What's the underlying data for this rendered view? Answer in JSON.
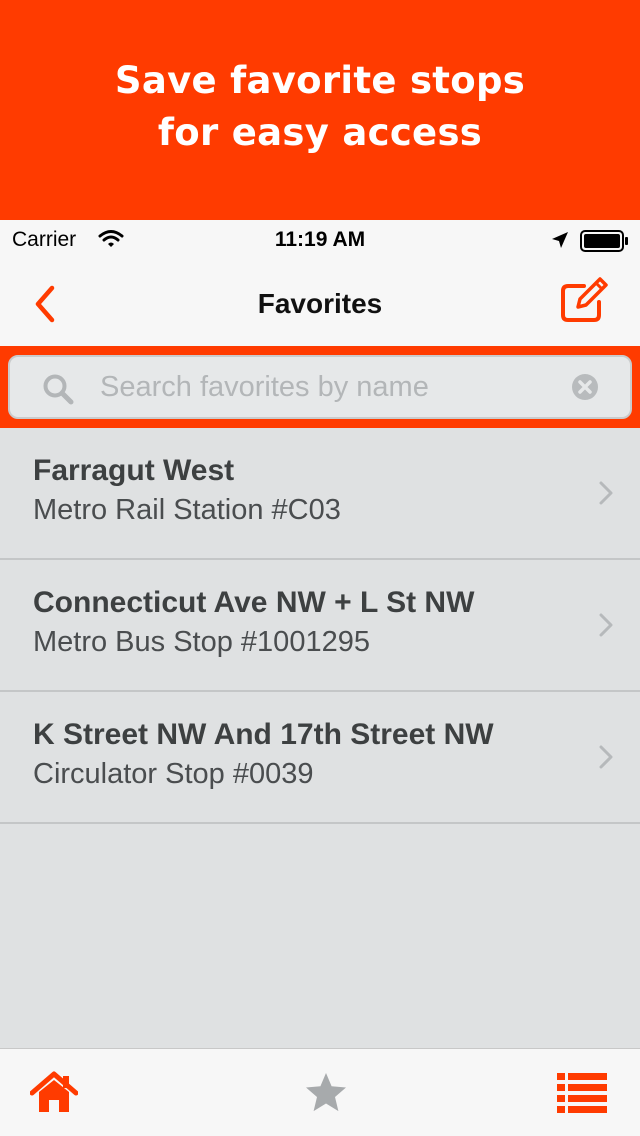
{
  "promo": {
    "line1": "Save favorite stops",
    "line2": "for easy access"
  },
  "status_bar": {
    "carrier": "Carrier",
    "time": "11:19 AM",
    "icons": [
      "wifi-icon",
      "location-arrow-icon",
      "battery-icon"
    ]
  },
  "nav": {
    "title": "Favorites",
    "back_icon": "chevron-left-icon",
    "edit_icon": "compose-icon"
  },
  "search": {
    "placeholder": "Search favorites by name",
    "value": ""
  },
  "favorites": [
    {
      "name": "Farragut West",
      "detail": "Metro Rail Station #C03"
    },
    {
      "name": "Connecticut Ave NW + L St NW",
      "detail": "Metro Bus Stop #1001295"
    },
    {
      "name": "K Street NW And 17th Street NW",
      "detail": "Circulator Stop #0039"
    }
  ],
  "tab_bar": {
    "tabs": [
      "home-icon",
      "star-icon",
      "list-icon"
    ]
  },
  "colors": {
    "accent": "#ff3b00",
    "background": "#dfe1e2",
    "bar": "#f7f7f7"
  }
}
